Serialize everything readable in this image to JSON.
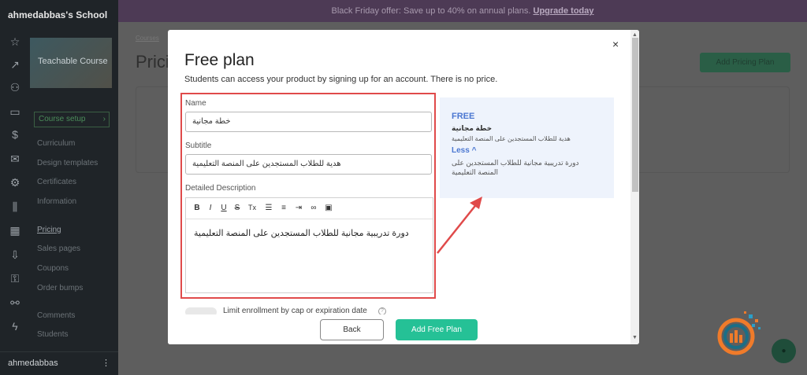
{
  "sidebar": {
    "school_name": "ahmedabbas's School",
    "course_thumb_label": "Teachable Course",
    "course_setup_label": "Course setup",
    "menu": [
      {
        "label": "Curriculum"
      },
      {
        "label": "Design templates"
      },
      {
        "label": "Certificates"
      },
      {
        "label": "Information"
      },
      {
        "label": "Pricing"
      },
      {
        "label": "Sales pages"
      },
      {
        "label": "Coupons"
      },
      {
        "label": "Order bumps"
      },
      {
        "label": "Comments"
      },
      {
        "label": "Students"
      }
    ],
    "user": "ahmedabbas",
    "rail_icons": [
      "star-icon",
      "trend-icon",
      "users-icon",
      "devices-icon",
      "dollar-icon",
      "mail-icon",
      "gear-icon",
      "library-icon",
      "calendar-icon",
      "download-icon",
      "key-icon",
      "sitemap-icon",
      "bolt-icon"
    ]
  },
  "banner": {
    "text": "Black Friday offer:  Save up to 40% on annual plans.",
    "link": "Upgrade today"
  },
  "background_page": {
    "breadcrumb": "Courses",
    "title": "Prici",
    "add_button": "Add Pricing Plan"
  },
  "modal": {
    "title": "Free plan",
    "subtitle": "Students can access your product by signing up for an account. There is no price.",
    "close": "×",
    "name_label": "Name",
    "name_value": "خطة مجانية",
    "subtitle_label": "Subtitle",
    "subtitle_value": "هدية للطلاب المستجدين على المنصة التعليمية",
    "description_label": "Detailed Description",
    "toolbar": [
      "B",
      "I",
      "U",
      "S",
      "Tx",
      "ol",
      "ul",
      "indent",
      "link",
      "image"
    ],
    "description_value": "دورة تدريبية مجانية للطلاب المستجدين على المنصة التعليمية",
    "preview": {
      "free": "FREE",
      "name": "خطة مجانية",
      "subtitle": "هدية للطلاب المستجدين على المنصة التعليمية",
      "less": "Less ^",
      "description": "دورة تدريبية مجانية للطلاب المستجدين على المنصة التعليمية"
    },
    "limit_label": "Limit enrollment by cap or expiration date",
    "back_button": "Back",
    "add_button": "Add Free Plan"
  },
  "colors": {
    "accent_green": "#25c196",
    "highlight_red": "#e04a4a",
    "preview_blue": "#4b77d1"
  }
}
